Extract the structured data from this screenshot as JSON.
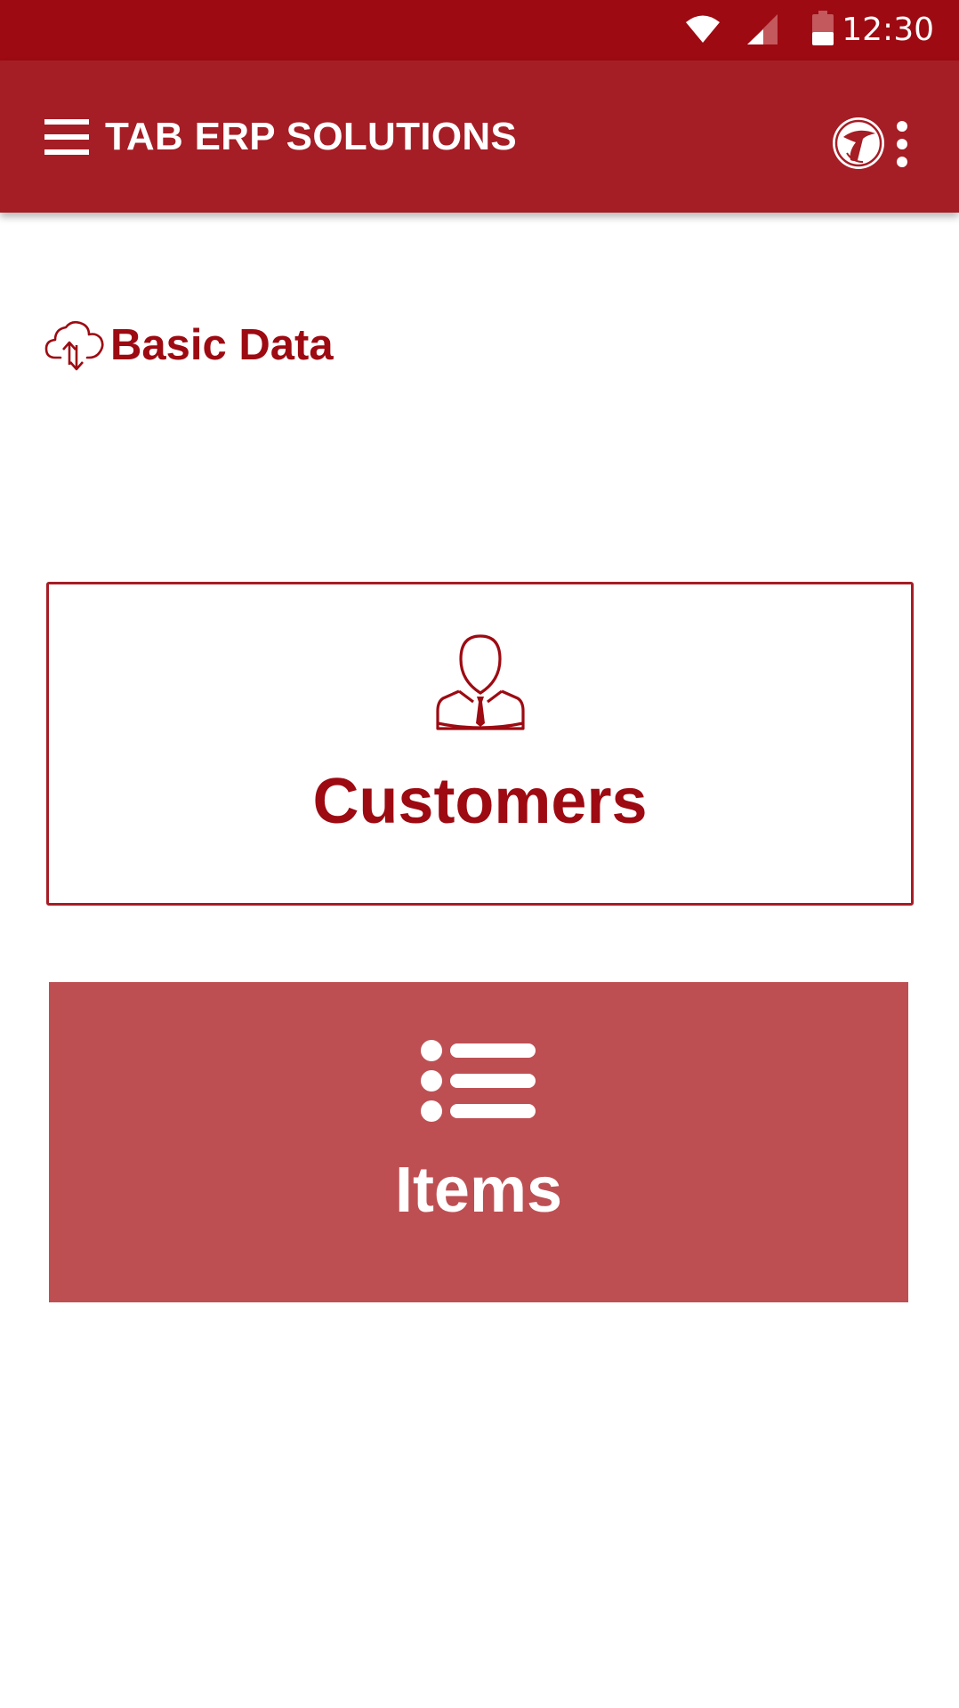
{
  "status_bar": {
    "time": "12:30",
    "icons": [
      "wifi-icon",
      "cell-signal-icon",
      "battery-icon"
    ]
  },
  "app_bar": {
    "title": "TAB ERP SOLUTIONS",
    "menu_icon": "hamburger-menu-icon",
    "logo_icon": "brand-logo-icon",
    "overflow_icon": "more-vert-icon"
  },
  "section": {
    "title": "Basic Data",
    "icon": "cloud-sync-icon"
  },
  "cards": {
    "customers": {
      "label": "Customers",
      "icon": "customer-person-icon"
    },
    "items": {
      "label": "Items",
      "icon": "list-icon"
    }
  },
  "colors": {
    "status_bar": "#9d0a12",
    "app_bar": "#a51d25",
    "accent": "#9d0a12",
    "items_card": "#bd4f53",
    "background": "#ffffff"
  }
}
